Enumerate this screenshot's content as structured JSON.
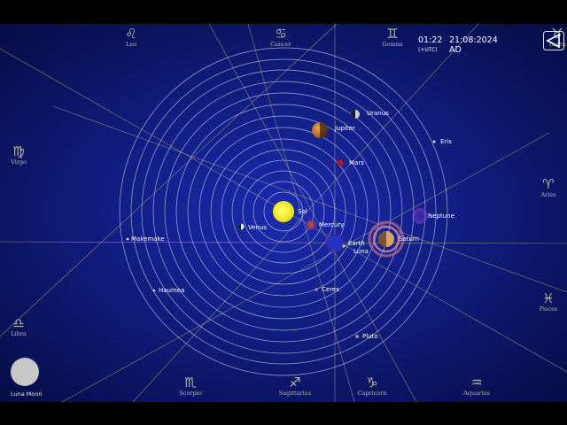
{
  "clock": {
    "time": "01:22",
    "date": "21:08:2024 AD",
    "timezone": "(+UTC)"
  },
  "zodiac": [
    {
      "id": "leo",
      "glyph": "♌",
      "name": "Leo"
    },
    {
      "id": "cancer",
      "glyph": "♋",
      "name": "Cancer"
    },
    {
      "id": "gemini",
      "glyph": "♊",
      "name": "Gemini"
    },
    {
      "id": "taurus",
      "glyph": "♉",
      "name": "Taurus"
    },
    {
      "id": "virgo",
      "glyph": "♍",
      "name": "Virgo"
    },
    {
      "id": "aries",
      "glyph": "♈",
      "name": "Aries"
    },
    {
      "id": "libra",
      "glyph": "♎",
      "name": "Libra"
    },
    {
      "id": "pisces",
      "glyph": "♓",
      "name": "Pisces"
    },
    {
      "id": "scorpio",
      "glyph": "♏",
      "name": "Scorpio"
    },
    {
      "id": "sagittarius",
      "glyph": "♐",
      "name": "Sagittarius"
    },
    {
      "id": "capricorn",
      "glyph": "♑",
      "name": "Capricorn"
    },
    {
      "id": "aquarius",
      "glyph": "♒",
      "name": "Aquarius"
    }
  ],
  "bodies": {
    "sol": "Sol",
    "mercury": "Mercury",
    "venus": "Venus",
    "earth": "Earth",
    "luna": "Luna",
    "mars": "Mars",
    "jupiter": "Jupiter",
    "saturn": "Saturn",
    "uranus": "Uranus",
    "neptune": "Neptune",
    "pluto": "Pluto",
    "ceres": "Ceres",
    "eris": "Eris",
    "makemake": "Makemake",
    "haumea": "Haumea"
  },
  "colors": {
    "sky_center": "#1a2bb0",
    "sky_edge": "#040a3e",
    "orbit": "#c9c9e6",
    "sun": "#f4f000",
    "mars": "#b81818",
    "jupiter": "#c87a2a",
    "neptune": "#8a4fd8",
    "earth": "#2a3ad0",
    "saturn": "#d7a46a"
  },
  "moon_button": {
    "label": "Luna Moon"
  },
  "back_button": {
    "icon": "back-triangle-icon"
  }
}
